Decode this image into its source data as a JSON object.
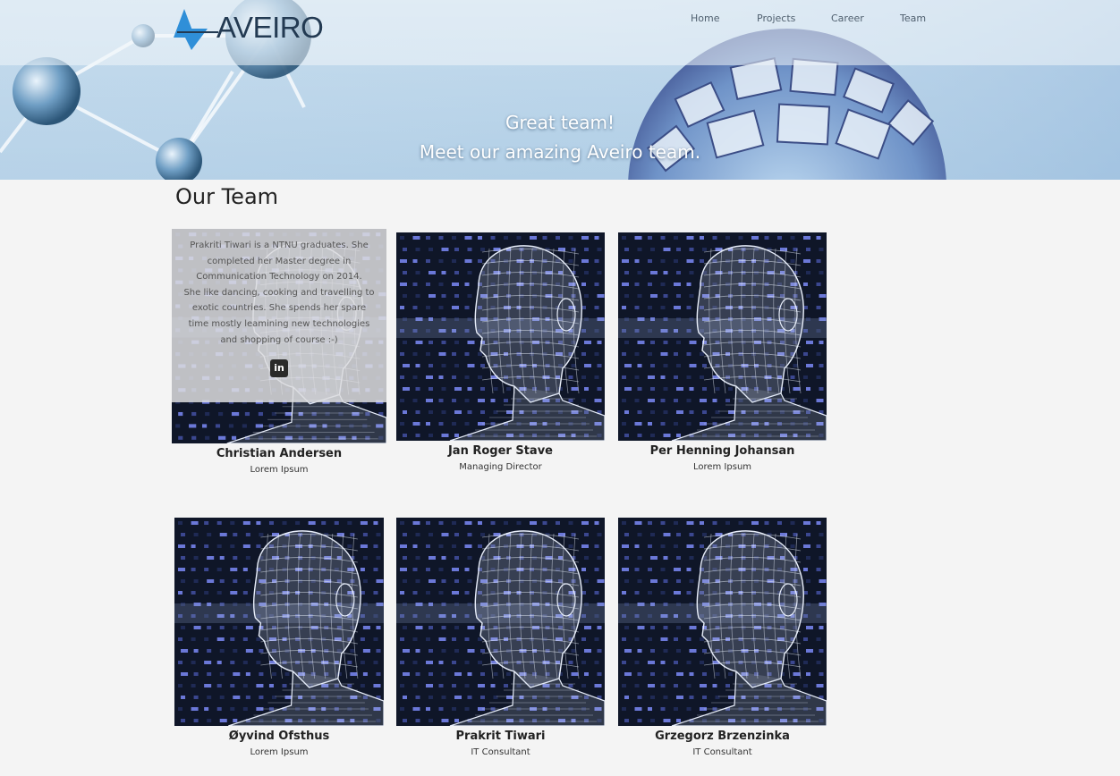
{
  "brand": {
    "name": "AVEIRO",
    "accent": "#2f8fd8",
    "text_color": "#233a52"
  },
  "nav": {
    "items": [
      {
        "label": "Home"
      },
      {
        "label": "Projects"
      },
      {
        "label": "Career"
      },
      {
        "label": "Team"
      }
    ]
  },
  "hero": {
    "line1": "Great team!",
    "line2": "Meet our amazing Aveiro team."
  },
  "team": {
    "title": "Our Team",
    "social_icon": "linkedin-icon",
    "social_label": "in",
    "members": [
      {
        "name": "Christian Andersen",
        "role": "Lorem Ipsum",
        "bio": [
          "Prakriti Tiwari is a NTNU graduates. She",
          "completed her Master degree in",
          "Communication Technology on 2014.",
          "She like dancing, cooking and travelling to",
          "exotic countries. She spends her spare",
          "time mostly leamining new technologies",
          "and shopping of course :-)"
        ]
      },
      {
        "name": "Jan Roger Stave",
        "role": "Managing Director"
      },
      {
        "name": "Per Henning Johansan",
        "role": "Lorem Ipsum"
      },
      {
        "name": "Øyvind Ofsthus",
        "role": "Lorem Ipsum"
      },
      {
        "name": "Prakrit Tiwari",
        "role": "IT Consultant"
      },
      {
        "name": "Grzegorz Brzenzinka",
        "role": "IT Consultant"
      }
    ]
  }
}
